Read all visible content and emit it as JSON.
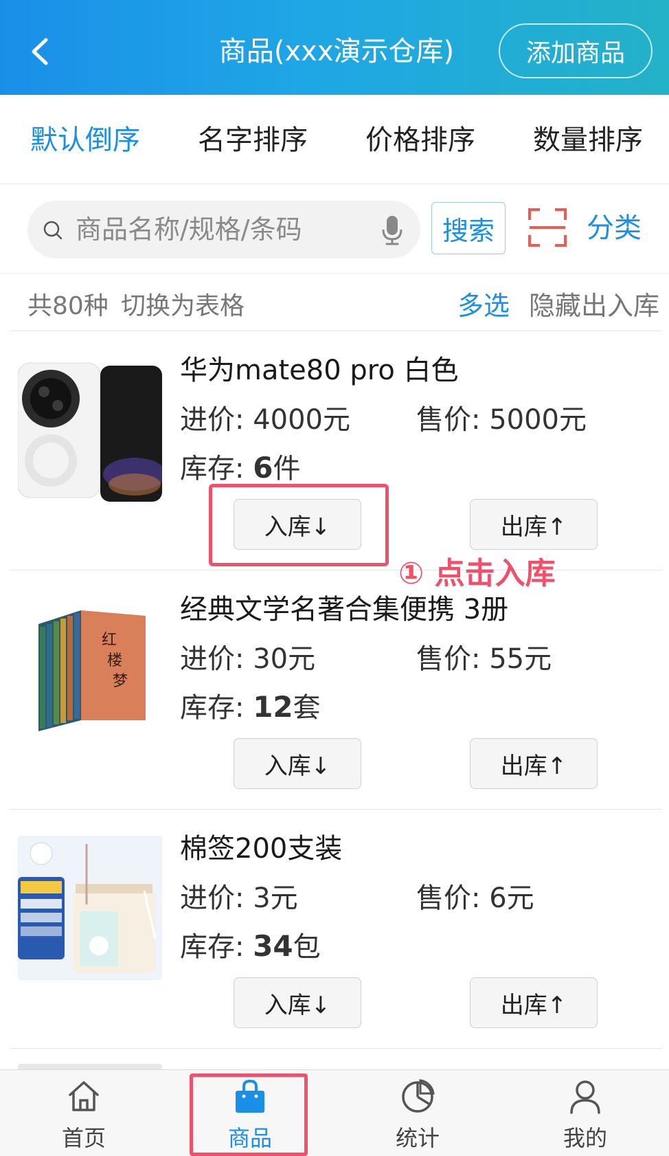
{
  "header": {
    "title": "商品(xxx演示仓库)",
    "add_button": "添加商品",
    "gradient_colors": [
      "#1a8fe8",
      "#23b2c8"
    ]
  },
  "sort_tabs": [
    {
      "label": "默认倒序",
      "active": true
    },
    {
      "label": "名字排序",
      "active": false
    },
    {
      "label": "价格排序",
      "active": false
    },
    {
      "label": "数量排序",
      "active": false
    }
  ],
  "search": {
    "placeholder": "商品名称/规格/条码",
    "button": "搜索",
    "category": "分类"
  },
  "info": {
    "count": "共80种",
    "switch_view": "切换为表格",
    "multi_select": "多选",
    "hide_io": "隐藏出入库"
  },
  "products": [
    {
      "name": "华为mate80 pro   白色",
      "buy_price": "进价: 4000元",
      "sell_price": "售价: 5000元",
      "stock_label": "库存: ",
      "stock_value": "6",
      "stock_unit": "件",
      "in_button": "入库↓",
      "out_button": "出库↑"
    },
    {
      "name": "经典文学名著合集便携   3册",
      "buy_price": "进价: 30元",
      "sell_price": "售价: 55元",
      "stock_label": "库存: ",
      "stock_value": "12",
      "stock_unit": "套",
      "in_button": "入库↓",
      "out_button": "出库↑"
    },
    {
      "name": "棉签200支装",
      "buy_price": "进价: 3元",
      "sell_price": "售价: 6元",
      "stock_label": "库存: ",
      "stock_value": "34",
      "stock_unit": "包",
      "in_button": "入库↓",
      "out_button": "出库↑"
    }
  ],
  "annotation": {
    "text": "① 点击入库",
    "color": "#f0506a"
  },
  "bottom_nav": [
    {
      "label": "首页",
      "icon": "home-icon",
      "active": false
    },
    {
      "label": "商品",
      "icon": "shopping-bag-icon",
      "active": true
    },
    {
      "label": "统计",
      "icon": "pie-chart-icon",
      "active": false
    },
    {
      "label": "我的",
      "icon": "user-icon",
      "active": false
    }
  ],
  "accent_color": "#1a8fe8"
}
